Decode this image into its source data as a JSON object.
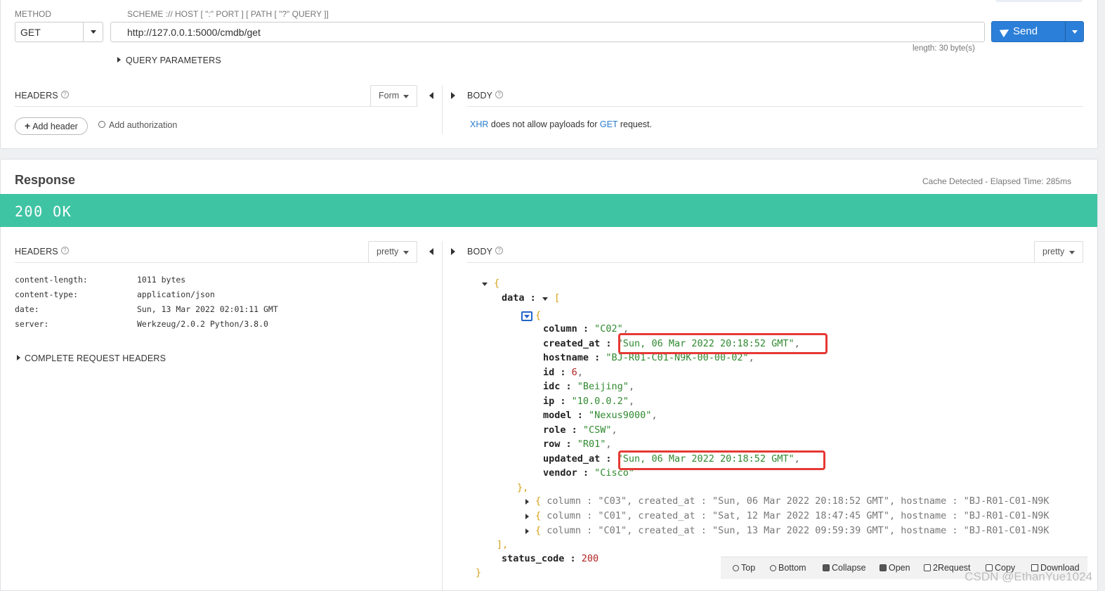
{
  "request": {
    "method_label": "METHOD",
    "method_value": "GET",
    "url_label": "SCHEME :// HOST [ \":\" PORT ] [ PATH [ \"?\" QUERY ]]",
    "url_value": "http://127.0.0.1:5000/cmdb/get",
    "send_label": "Send",
    "length_text": "length: 30 byte(s)",
    "query_params_label": "QUERY PARAMETERS",
    "headers_label": "HEADERS",
    "headers_mode": "Form",
    "body_label": "BODY",
    "add_header_label": "Add header",
    "add_authorization_label": "Add authorization",
    "body_msg": {
      "xhr": "XHR",
      "mid": "does not allow payloads for",
      "get": "GET",
      "end": "request."
    }
  },
  "response": {
    "title": "Response",
    "elapsed_text": "Cache Detected - Elapsed Time: 285ms",
    "status_text": "200 OK",
    "status_color": "#3fc4a3",
    "headers_label": "HEADERS",
    "headers_format": "pretty",
    "body_label": "BODY",
    "body_format": "pretty",
    "headers": [
      {
        "key": "content-length:",
        "value": "1011 bytes"
      },
      {
        "key": "content-type:",
        "value": "application/json"
      },
      {
        "key": "date:",
        "value": "Sun, 13 Mar 2022 02:01:11 GMT"
      },
      {
        "key": "server:",
        "value": "Werkzeug/2.0.2 Python/3.8.0"
      }
    ],
    "complete_request_headers_label": "COMPLETE REQUEST HEADERS",
    "json": {
      "data_key": "data",
      "item": [
        {
          "key": "column",
          "value": "\"C02\"",
          "type": "str"
        },
        {
          "key": "created_at",
          "value": "\"Sun, 06 Mar 2022 20:18:52 GMT\"",
          "type": "str"
        },
        {
          "key": "hostname",
          "value": "\"BJ-R01-C01-N9K-00-00-02\"",
          "type": "str"
        },
        {
          "key": "id",
          "value": "6",
          "type": "num"
        },
        {
          "key": "idc",
          "value": "\"Beijing\"",
          "type": "str"
        },
        {
          "key": "ip",
          "value": "\"10.0.0.2\"",
          "type": "str"
        },
        {
          "key": "model",
          "value": "\"Nexus9000\"",
          "type": "str"
        },
        {
          "key": "role",
          "value": "\"CSW\"",
          "type": "str"
        },
        {
          "key": "row",
          "value": "\"R01\"",
          "type": "str"
        },
        {
          "key": "updated_at",
          "value": "\"Sun, 06 Mar 2022 20:18:52 GMT\"",
          "type": "str"
        },
        {
          "key": "vendor",
          "value": "\"Cisco\"",
          "type": "str"
        }
      ],
      "collapsed": [
        {
          "column": "\"C03\"",
          "created_at": "\"Sun, 06 Mar 2022 20:18:52 GMT\"",
          "hostname": "\"BJ-R01-C01-N9K"
        },
        {
          "column": "\"C01\"",
          "created_at": "\"Sat, 12 Mar 2022 18:47:45 GMT\"",
          "hostname": "\"BJ-R01-C01-N9K"
        },
        {
          "column": "\"C01\"",
          "created_at": "\"Sun, 13 Mar 2022 09:59:39 GMT\"",
          "hostname": "\"BJ-R01-C01-N9K"
        }
      ],
      "status_code_key": "status_code",
      "status_code_value": "200"
    },
    "toolbar": [
      "Top",
      "Bottom",
      "Collapse",
      "Open",
      "2Request",
      "Copy",
      "Download"
    ]
  },
  "watermark": "CSDN @EthanYue1024"
}
